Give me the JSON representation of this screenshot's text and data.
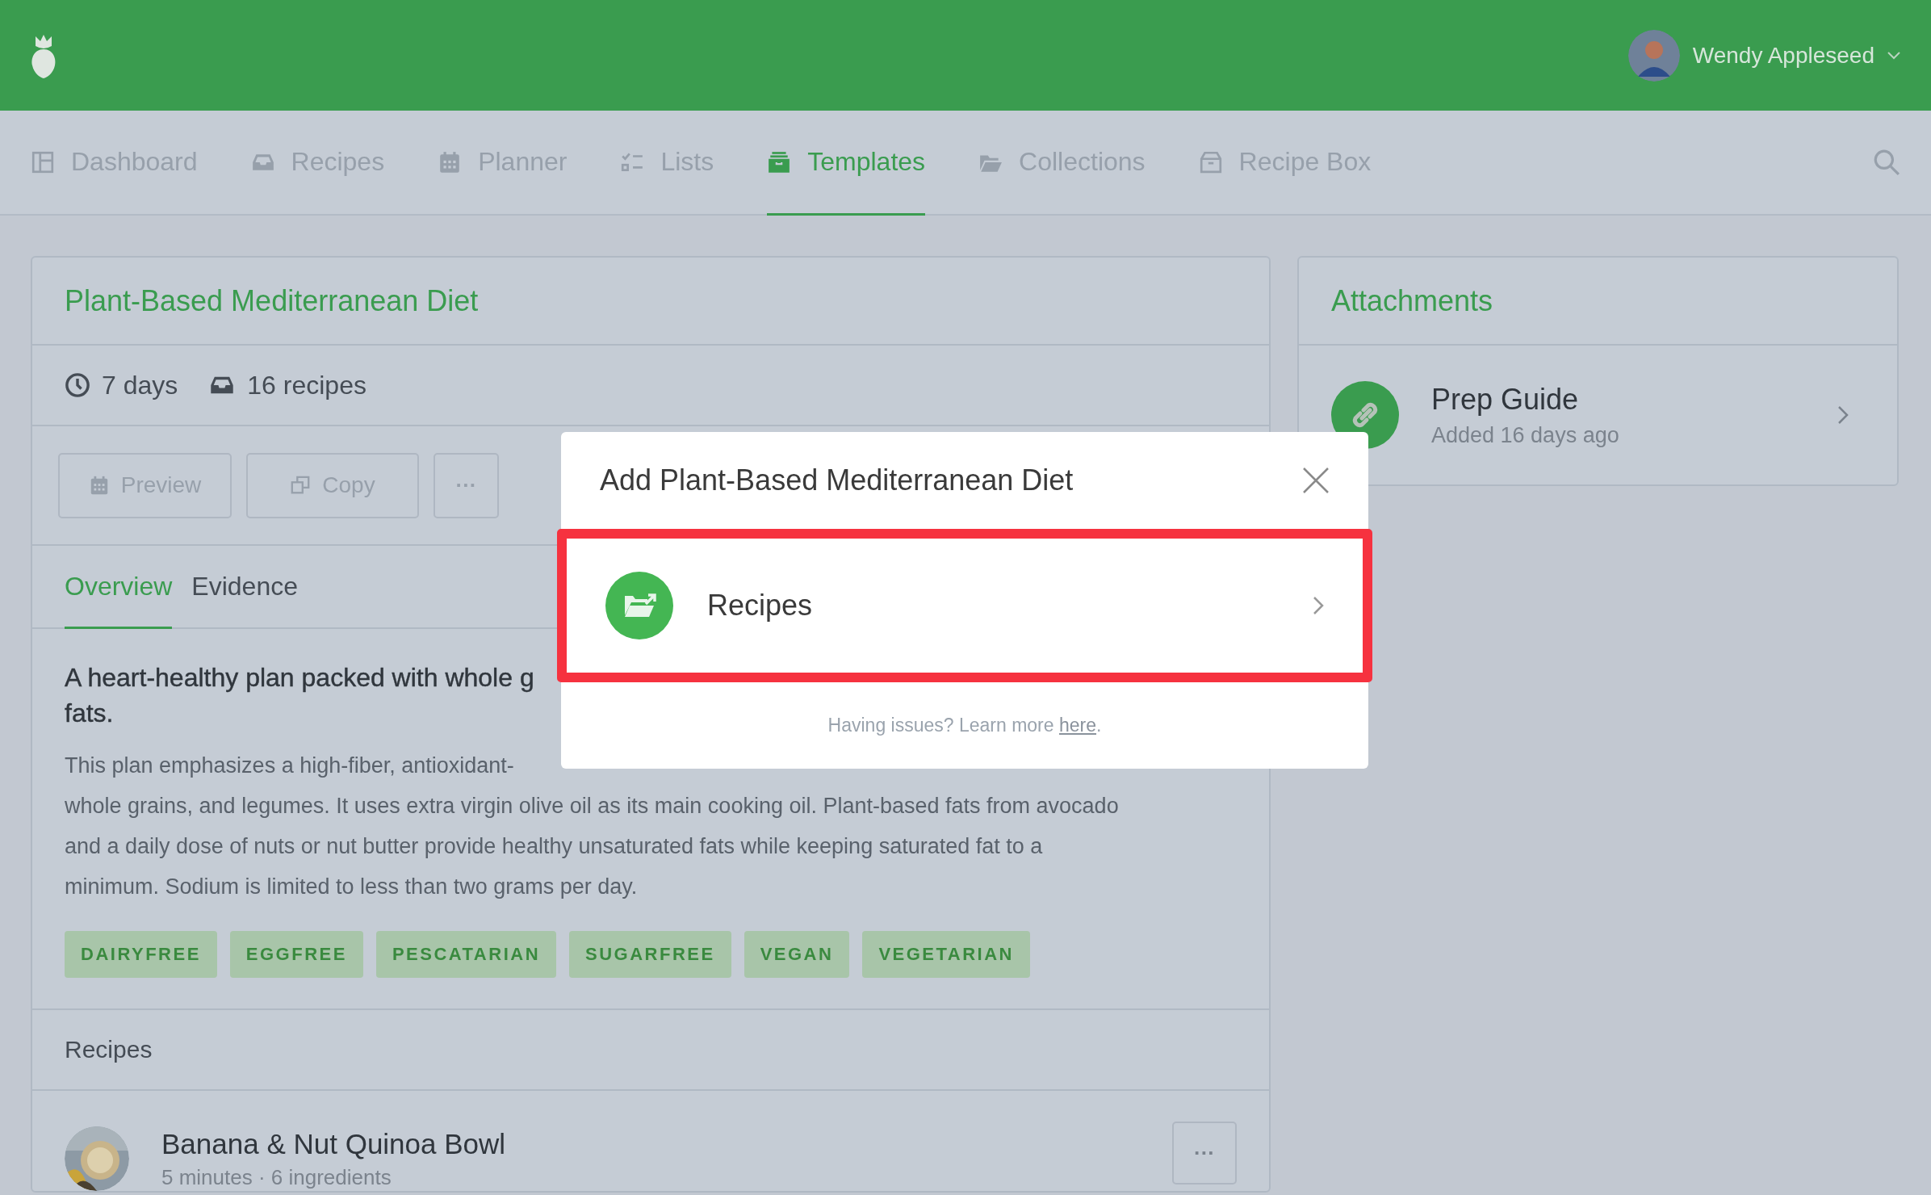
{
  "header": {
    "user_name": "Wendy Appleseed"
  },
  "nav": [
    {
      "label": "Dashboard",
      "selected": false
    },
    {
      "label": "Recipes",
      "selected": false
    },
    {
      "label": "Planner",
      "selected": false
    },
    {
      "label": "Lists",
      "selected": false
    },
    {
      "label": "Templates",
      "selected": true
    },
    {
      "label": "Collections",
      "selected": false
    },
    {
      "label": "Recipe Box",
      "selected": false
    }
  ],
  "plan": {
    "title": "Plant-Based Mediterranean Diet",
    "meta": [
      {
        "text": "7 days"
      },
      {
        "text": "16 recipes"
      }
    ],
    "actions": [
      {
        "kind": "preview",
        "label": "Preview"
      },
      {
        "kind": "copy",
        "label": "Copy"
      },
      {
        "kind": "more",
        "label": "···"
      }
    ],
    "tabs": [
      {
        "label": "Overview",
        "selected": true
      },
      {
        "label": "Evidence",
        "selected": false
      }
    ],
    "heading_lines": [
      "A heart-healthy plan packed with whole g",
      "fats."
    ],
    "description_lines": [
      "This plan emphasizes a high-fiber, antioxidant-",
      "whole grains, and legumes. It uses extra virgin olive oil as its main cooking oil. Plant-based fats from avocado",
      "and a daily dose of nuts or nut butter provide healthy unsaturated fats while keeping saturated fat to a",
      "minimum. Sodium is limited to less than two grams per day."
    ],
    "tags": [
      "DAIRYFREE",
      "EGGFREE",
      "PESCATARIAN",
      "SUGARFREE",
      "VEGAN",
      "VEGETARIAN"
    ],
    "recipes_heading": "Recipes",
    "recipes": [
      {
        "title": "Banana & Nut Quinoa Bowl",
        "details": "5 minutes · 6 ingredients",
        "more": "···"
      }
    ]
  },
  "attachments": {
    "title": "Attachments",
    "items": [
      {
        "title": "Prep Guide",
        "subtitle": "Added 16 days ago"
      }
    ]
  },
  "modal": {
    "title": "Add Plant-Based Mediterranean Diet",
    "options": [
      {
        "label": "Recipes",
        "highlighted": true
      }
    ],
    "footer": "Having issues? Learn more ",
    "footer_link": "here",
    "footer_end": "."
  }
}
